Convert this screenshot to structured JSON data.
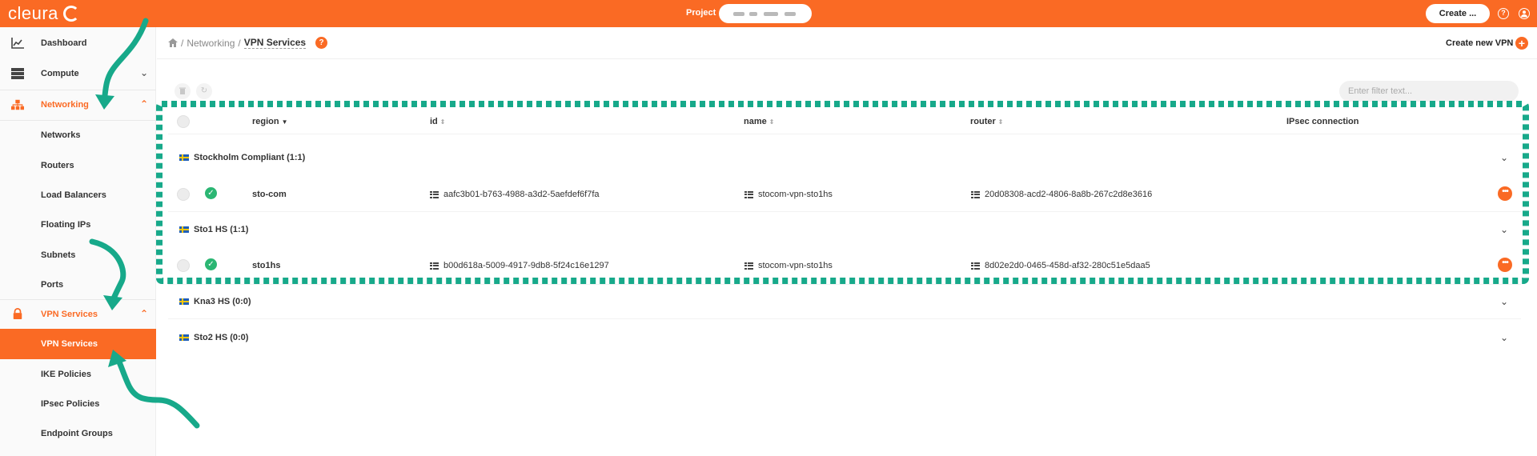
{
  "brand": {
    "logo_text": "cleura",
    "accent": "#fa6a24"
  },
  "topbar": {
    "project_label": "Project",
    "create_label": "Create ...",
    "help_icon": "help-icon",
    "user_icon": "user-icon"
  },
  "sidebar": {
    "items": [
      {
        "label": "Dashboard",
        "icon": "chart-icon"
      },
      {
        "label": "Compute",
        "icon": "server-icon"
      },
      {
        "label": "Networking",
        "icon": "network-icon"
      },
      {
        "label": "Networks"
      },
      {
        "label": "Routers"
      },
      {
        "label": "Load Balancers"
      },
      {
        "label": "Floating IPs"
      },
      {
        "label": "Subnets"
      },
      {
        "label": "Ports"
      },
      {
        "label": "VPN Services",
        "icon": "lock-icon"
      },
      {
        "label": "VPN Services"
      },
      {
        "label": "IKE Policies"
      },
      {
        "label": "IPsec Policies"
      },
      {
        "label": "Endpoint Groups"
      }
    ]
  },
  "header": {
    "breadcrumb": [
      "Networking",
      "VPN Services"
    ],
    "help_badge": "?",
    "create_vpn_label": "Create new VPN"
  },
  "toolbar": {
    "filter_placeholder": "Enter filter text..."
  },
  "table": {
    "columns": [
      "region",
      "id",
      "name",
      "router",
      "IPsec connection"
    ],
    "groups": [
      {
        "label": "Stockholm Compliant (1:1)",
        "rows": [
          {
            "region": "sto-com",
            "id": "aafc3b01-b763-4988-a3d2-5aefdef6f7fa",
            "name": "stocom-vpn-sto1hs",
            "router": "20d08308-acd2-4806-8a8b-267c2d8e3616",
            "status": "ok"
          }
        ]
      },
      {
        "label": "Sto1 HS (1:1)",
        "rows": [
          {
            "region": "sto1hs",
            "id": "b00d618a-5009-4917-9db8-5f24c16e1297",
            "name": "stocom-vpn-sto1hs",
            "router": "8d02e2d0-0465-458d-af32-280c51e5daa5",
            "status": "ok"
          }
        ]
      },
      {
        "label": "Kna3 HS (0:0)",
        "rows": []
      },
      {
        "label": "Sto2 HS (0:0)",
        "rows": []
      }
    ]
  }
}
